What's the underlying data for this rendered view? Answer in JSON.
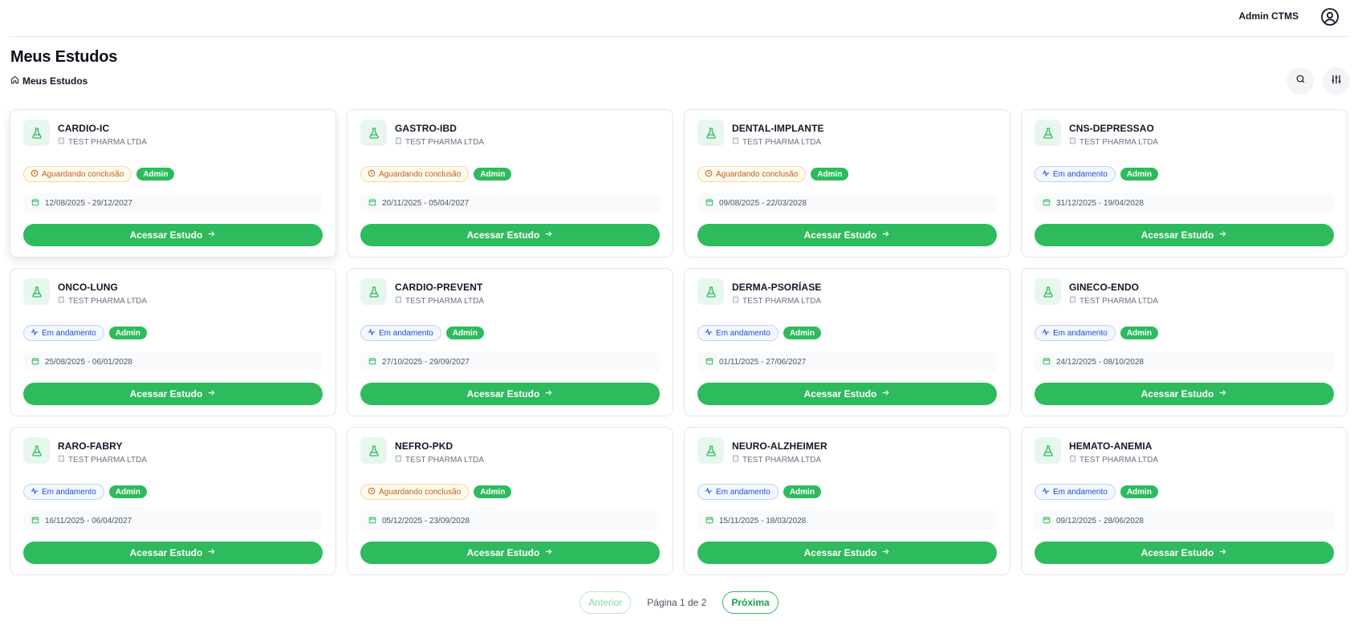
{
  "header": {
    "user_name": "Admin CTMS"
  },
  "page": {
    "title": "Meus Estudos",
    "breadcrumb": "Meus Estudos"
  },
  "studies": [
    {
      "name": "CARDIO-IC",
      "org": "TEST PHARMA LTDA",
      "status": "Aguardando conclusão",
      "status_type": "pending",
      "role": "Admin",
      "dates": "12/08/2025 - 29/12/2027",
      "action": "Acessar Estudo"
    },
    {
      "name": "GASTRO-IBD",
      "org": "TEST PHARMA LTDA",
      "status": "Aguardando conclusão",
      "status_type": "pending",
      "role": "Admin",
      "dates": "20/11/2025 - 05/04/2027",
      "action": "Acessar Estudo"
    },
    {
      "name": "DENTAL-IMPLANTE",
      "org": "TEST PHARMA LTDA",
      "status": "Aguardando conclusão",
      "status_type": "pending",
      "role": "Admin",
      "dates": "09/08/2025 - 22/03/2028",
      "action": "Acessar Estudo"
    },
    {
      "name": "CNS-DEPRESSAO",
      "org": "TEST PHARMA LTDA",
      "status": "Em andamento",
      "status_type": "ongoing",
      "role": "Admin",
      "dates": "31/12/2025 - 19/04/2028",
      "action": "Acessar Estudo"
    },
    {
      "name": "ONCO-LUNG",
      "org": "TEST PHARMA LTDA",
      "status": "Em andamento",
      "status_type": "ongoing",
      "role": "Admin",
      "dates": "25/08/2025 - 06/01/2028",
      "action": "Acessar Estudo"
    },
    {
      "name": "CARDIO-PREVENT",
      "org": "TEST PHARMA LTDA",
      "status": "Em andamento",
      "status_type": "ongoing",
      "role": "Admin",
      "dates": "27/10/2025 - 29/09/2027",
      "action": "Acessar Estudo"
    },
    {
      "name": "DERMA-PSORÍASE",
      "org": "TEST PHARMA LTDA",
      "status": "Em andamento",
      "status_type": "ongoing",
      "role": "Admin",
      "dates": "01/11/2025 - 27/06/2027",
      "action": "Acessar Estudo"
    },
    {
      "name": "GINECO-ENDO",
      "org": "TEST PHARMA LTDA",
      "status": "Em andamento",
      "status_type": "ongoing",
      "role": "Admin",
      "dates": "24/12/2025 - 08/10/2028",
      "action": "Acessar Estudo"
    },
    {
      "name": "RARO-FABRY",
      "org": "TEST PHARMA LTDA",
      "status": "Em andamento",
      "status_type": "ongoing",
      "role": "Admin",
      "dates": "16/11/2025 - 06/04/2027",
      "action": "Acessar Estudo"
    },
    {
      "name": "NEFRO-PKD",
      "org": "TEST PHARMA LTDA",
      "status": "Aguardando conclusão",
      "status_type": "pending",
      "role": "Admin",
      "dates": "05/12/2025 - 23/09/2028",
      "action": "Acessar Estudo"
    },
    {
      "name": "NEURO-ALZHEIMER",
      "org": "TEST PHARMA LTDA",
      "status": "Em andamento",
      "status_type": "ongoing",
      "role": "Admin",
      "dates": "15/11/2025 - 18/03/2028",
      "action": "Acessar Estudo"
    },
    {
      "name": "HEMATO-ANEMIA",
      "org": "TEST PHARMA LTDA",
      "status": "Em andamento",
      "status_type": "ongoing",
      "role": "Admin",
      "dates": "09/12/2025 - 28/06/2028",
      "action": "Acessar Estudo"
    }
  ],
  "pagination": {
    "prev_label": "Anterior",
    "info": "Página 1 de 2",
    "next_label": "Próxima"
  },
  "icons": {
    "header": "user-circle-icon",
    "breadcrumb": "home-icon",
    "search": "search-icon",
    "filter": "sliders-icon",
    "card": "flask-icon",
    "org": "building-icon",
    "pending": "clock-icon",
    "ongoing": "activity-icon",
    "dates": "calendar-icon",
    "action": "arrow-right-icon"
  },
  "colors": {
    "accent": "#2dbb5d",
    "pending": "#c2610c",
    "ongoing": "#1d4ed8"
  }
}
